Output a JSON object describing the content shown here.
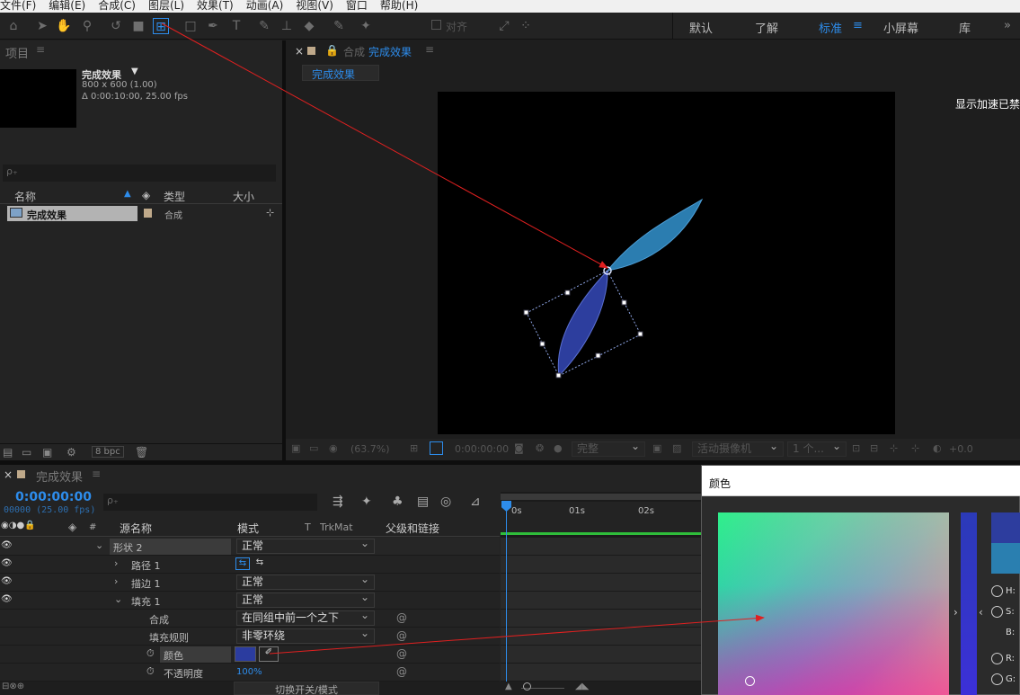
{
  "menubar": [
    "文件(F)",
    "编辑(E)",
    "合成(C)",
    "图层(L)",
    "效果(T)",
    "动画(A)",
    "视图(V)",
    "窗口",
    "帮助(H)"
  ],
  "toolbar": {
    "align_label": "对齐",
    "workspaces": [
      "默认",
      "了解",
      "标准",
      "小屏幕",
      "库"
    ],
    "active_workspace": "标准",
    "more": "»"
  },
  "project": {
    "panel_title": "项目",
    "comp_name": "完成效果",
    "dims": "800 x 600 (1.00)",
    "duration": "Δ 0:00:10:00, 25.00 fps",
    "search_placeholder": "ρ₊",
    "col_name": "名称",
    "col_type": "类型",
    "col_size": "大小",
    "item_name": "完成效果",
    "item_type": "合成",
    "bpc": "8 bpc"
  },
  "comp_panel": {
    "title_prefix": "合成",
    "title": "完成效果",
    "tab": "完成效果",
    "accel_msg": "显示加速已禁",
    "zoom": "(63.7%)",
    "time": "0:00:00:00",
    "quality": "完整",
    "camera": "活动摄像机",
    "views": "1 个...",
    "exposure": "+0.0"
  },
  "timeline": {
    "panel_title": "完成效果",
    "timecode": "0:00:00:00",
    "frames": "00000 (25.00 fps)",
    "search_placeholder": "ρ₊",
    "col_num": "#",
    "col_source": "源名称",
    "col_mode": "模式",
    "col_t": "T",
    "col_trkmat": "TrkMat",
    "col_parent": "父级和链接",
    "ruler": [
      "0s",
      "01s",
      "02s"
    ],
    "rows": [
      {
        "name": "形状 2",
        "mode": "正常"
      },
      {
        "name": "路径 1",
        "mode": ""
      },
      {
        "name": "描边 1",
        "mode": "正常"
      },
      {
        "name": "填充 1",
        "mode": "正常"
      },
      {
        "name": "合成",
        "mode": "在同组中前一个之下"
      },
      {
        "name": "填充规则",
        "mode": "非零环绕"
      },
      {
        "name": "颜色",
        "mode": ""
      },
      {
        "name": "不透明度",
        "mode": "100%"
      }
    ],
    "footer": "切换开关/模式"
  },
  "color_dialog": {
    "title": "颜色",
    "fields": [
      "H:",
      "S:",
      "B:",
      "R:",
      "G:"
    ]
  },
  "colors": {
    "accent": "#2d8ceb",
    "petal_light": "#2a7fb0",
    "petal_dark": "#2d3d9e",
    "fill_swatch": "#2b3c9f",
    "arrow": "#e02020"
  }
}
